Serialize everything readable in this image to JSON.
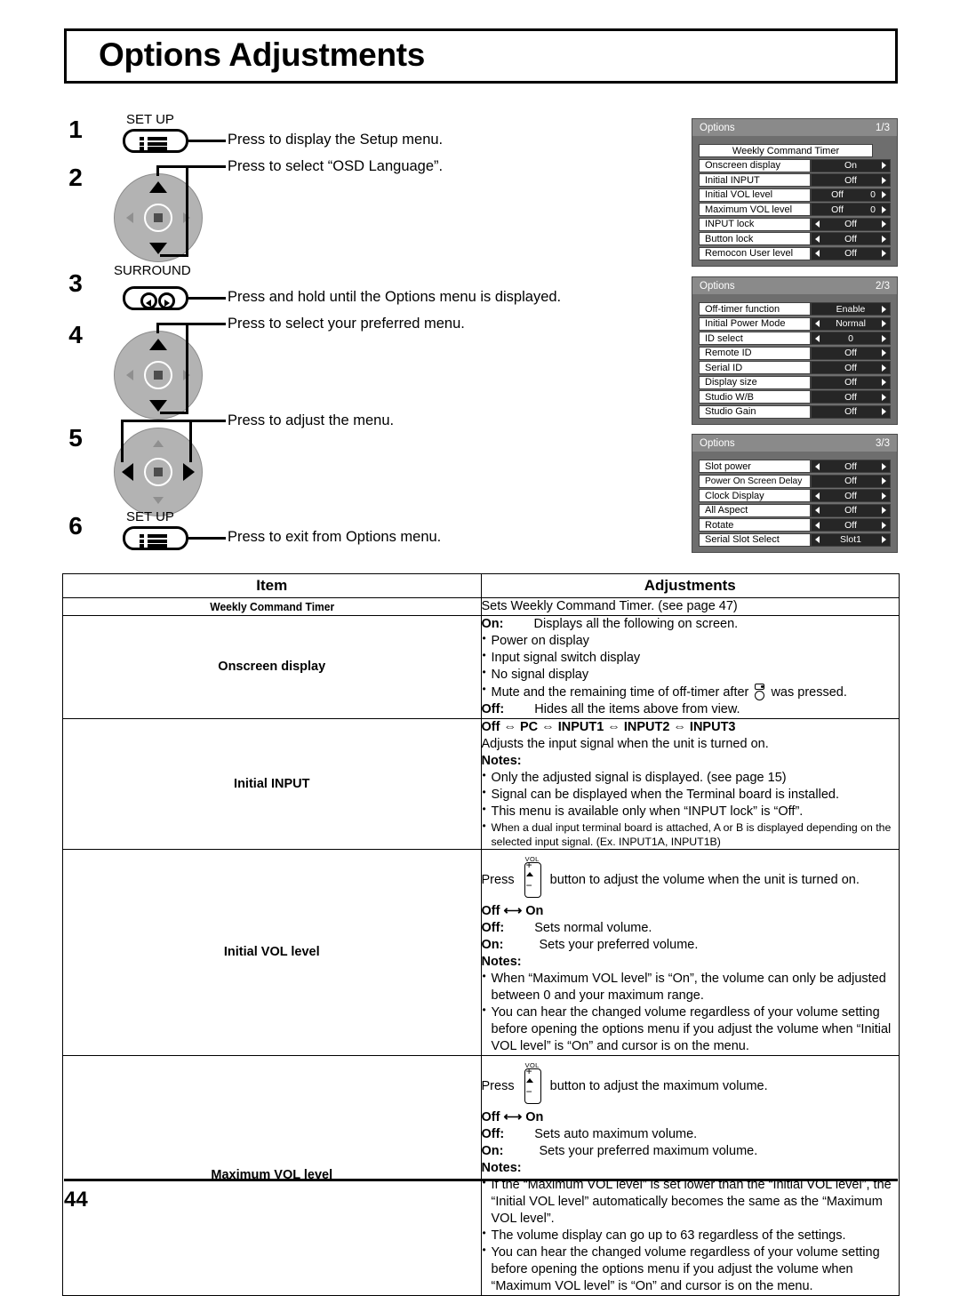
{
  "document": {
    "title": "Options Adjustments",
    "page_number": "44"
  },
  "steps": [
    {
      "number": "1",
      "button_label": "SET UP",
      "icon": "menu-list-icon",
      "text": "Press to display the Setup menu."
    },
    {
      "number": "2",
      "button_label": "",
      "icon": "dpad-up-down-icon",
      "text": "Press to select “OSD Language”."
    },
    {
      "number": "3",
      "button_label": "SURROUND",
      "icon": "surround-icon",
      "text": "Press and hold until the Options menu is displayed."
    },
    {
      "number": "4",
      "button_label": "",
      "icon": "dpad-up-down-icon",
      "text": "Press to select your preferred menu."
    },
    {
      "number": "5",
      "button_label": "",
      "icon": "dpad-left-right-icon",
      "text": "Press to adjust the menu."
    },
    {
      "number": "6",
      "button_label": "SET UP",
      "icon": "menu-list-icon",
      "text": "Press to exit from Options menu."
    }
  ],
  "osd_panels": [
    {
      "title": "Options",
      "page_indicator": "1/3",
      "rows": [
        {
          "label": "Weekly Command Timer",
          "value": null,
          "number": null,
          "left_arrow": false,
          "right_arrow": false,
          "full_width": true
        },
        {
          "label": "Onscreen display",
          "value": "On",
          "number": null,
          "left_arrow": false,
          "right_arrow": true,
          "full_width": false
        },
        {
          "label": "Initial INPUT",
          "value": "Off",
          "number": null,
          "left_arrow": false,
          "right_arrow": true,
          "full_width": false
        },
        {
          "label": "Initial VOL level",
          "value": "Off",
          "number": "0",
          "left_arrow": false,
          "right_arrow": true,
          "full_width": false
        },
        {
          "label": "Maximum VOL level",
          "value": "Off",
          "number": "0",
          "left_arrow": false,
          "right_arrow": true,
          "full_width": false
        },
        {
          "label": "INPUT lock",
          "value": "Off",
          "number": null,
          "left_arrow": true,
          "right_arrow": true,
          "full_width": false
        },
        {
          "label": "Button lock",
          "value": "Off",
          "number": null,
          "left_arrow": true,
          "right_arrow": true,
          "full_width": false
        },
        {
          "label": "Remocon User level",
          "value": "Off",
          "number": null,
          "left_arrow": true,
          "right_arrow": true,
          "full_width": false
        }
      ]
    },
    {
      "title": "Options",
      "page_indicator": "2/3",
      "rows": [
        {
          "label": "Off-timer function",
          "value": "Enable",
          "number": null,
          "left_arrow": false,
          "right_arrow": true,
          "full_width": false
        },
        {
          "label": "Initial Power Mode",
          "value": "Normal",
          "number": null,
          "left_arrow": true,
          "right_arrow": true,
          "full_width": false
        },
        {
          "label": "ID select",
          "value": "0",
          "number": null,
          "left_arrow": true,
          "right_arrow": true,
          "full_width": false
        },
        {
          "label": "Remote ID",
          "value": "Off",
          "number": null,
          "left_arrow": false,
          "right_arrow": true,
          "full_width": false
        },
        {
          "label": "Serial ID",
          "value": "Off",
          "number": null,
          "left_arrow": false,
          "right_arrow": true,
          "full_width": false
        },
        {
          "label": "Display size",
          "value": "Off",
          "number": null,
          "left_arrow": false,
          "right_arrow": true,
          "full_width": false
        },
        {
          "label": "Studio W/B",
          "value": "Off",
          "number": null,
          "left_arrow": false,
          "right_arrow": true,
          "full_width": false
        },
        {
          "label": "Studio Gain",
          "value": "Off",
          "number": null,
          "left_arrow": false,
          "right_arrow": true,
          "full_width": false
        }
      ]
    },
    {
      "title": "Options",
      "page_indicator": "3/3",
      "rows": [
        {
          "label": "Slot power",
          "value": "Off",
          "number": null,
          "left_arrow": true,
          "right_arrow": true,
          "full_width": false
        },
        {
          "label": "Power On Screen Delay",
          "value": "Off",
          "number": null,
          "left_arrow": false,
          "right_arrow": true,
          "full_width": false
        },
        {
          "label": "Clock Display",
          "value": "Off",
          "number": null,
          "left_arrow": true,
          "right_arrow": true,
          "full_width": false
        },
        {
          "label": "All Aspect",
          "value": "Off",
          "number": null,
          "left_arrow": true,
          "right_arrow": true,
          "full_width": false
        },
        {
          "label": "Rotate",
          "value": "Off",
          "number": null,
          "left_arrow": true,
          "right_arrow": true,
          "full_width": false
        },
        {
          "label": "Serial Slot Select",
          "value": "Slot1",
          "number": null,
          "left_arrow": true,
          "right_arrow": true,
          "full_width": false
        }
      ]
    }
  ],
  "table": {
    "headers": {
      "item": "Item",
      "adjustments": "Adjustments"
    },
    "rows": {
      "weekly_command_timer": {
        "item": "Weekly Command Timer",
        "description": "Sets Weekly Command Timer. (see page 47)"
      },
      "onscreen_display": {
        "item": "Onscreen display",
        "on_label": "On:",
        "on_text": "Displays all the following on screen.",
        "bullets": [
          "Power on display",
          "Input signal switch display",
          "No signal display"
        ],
        "mute_bullet_before": "Mute and the remaining time of off-timer after",
        "mute_bullet_after": "was pressed.",
        "off_label": "Off:",
        "off_text": "Hides all the items above from view."
      },
      "initial_input": {
        "item": "Initial INPUT",
        "sequence": "Off ⇔ PC ⇔ INPUT1 ⇔ INPUT2 ⇔ INPUT3",
        "description": "Adjusts the input signal when the unit is turned on.",
        "notes_label": "Notes:",
        "notes": [
          "Only the adjusted signal is displayed. (see page 15)",
          "Signal can be displayed when the Terminal board is installed.",
          "This menu is available only when “INPUT lock” is “Off”."
        ],
        "small_note": "When a dual input terminal board is attached, A or B is displayed depending on the selected input signal. (Ex. INPUT1A, INPUT1B)"
      },
      "initial_vol_level": {
        "item": "Initial VOL level",
        "press_before": "Press",
        "press_after": "button to adjust the volume when the unit is turned on.",
        "toggle": "Off ⟷ On",
        "off_label": "Off:",
        "off_text": "Sets normal volume.",
        "on_label": "On:",
        "on_text": "Sets your preferred volume.",
        "notes_label": "Notes:",
        "notes": [
          "When “Maximum VOL level” is “On”, the volume can only be adjusted between 0 and your maximum range.",
          "You can hear the changed volume regardless of your volume setting before opening the options menu if you adjust the volume when “Initial VOL level” is “On” and cursor is on the menu."
        ]
      },
      "maximum_vol_level": {
        "item": "Maximum VOL level",
        "press_before": "Press",
        "press_after": "button to adjust the maximum volume.",
        "toggle": "Off ⟷ On",
        "off_label": "Off:",
        "off_text": "Sets auto maximum volume.",
        "on_label": "On:",
        "on_text": "Sets your preferred maximum volume.",
        "notes_label": "Notes:",
        "notes": [
          "If the “Maximum VOL level” is set lower than the “Initial VOL level”, the “Initial VOL level” automatically becomes the same as the “Maximum VOL level”.",
          "The volume display can go up to 63 regardless of the settings.",
          "You can hear the changed volume regardless of your volume setting before opening the options menu if you adjust the volume when “Maximum VOL level” is “On” and cursor is on the menu."
        ]
      }
    }
  },
  "vol_glyph": {
    "label": "VOL",
    "plus": "+",
    "minus": "−"
  }
}
